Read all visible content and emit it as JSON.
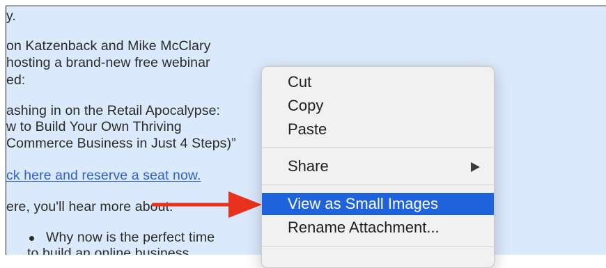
{
  "email": {
    "lines": [
      "y.",
      "on Katzenback and Mike McClary",
      " hosting a brand-new free webinar",
      "ed:",
      "ashing in on the Retail Apocalypse:",
      "w to Build Your Own Thriving",
      "Commerce Business in Just 4 Steps)”",
      "ck here and reserve a seat now.",
      "ere, you'll hear more about:",
      "Why now is the perfect time",
      "to build an online business"
    ]
  },
  "context_menu": {
    "items": [
      {
        "label": "Cut"
      },
      {
        "label": "Copy"
      },
      {
        "label": "Paste"
      },
      {
        "label": "Share",
        "submenu_icon": "chevron-right-icon"
      },
      {
        "label": "View as Small Images",
        "selected": true
      },
      {
        "label": "Rename Attachment..."
      }
    ]
  },
  "annotation": {
    "icon": "red-arrow-icon",
    "color": "#e8321e"
  },
  "colors": {
    "email_background": "#dbe9fc",
    "link": "#2d5fc7",
    "menu_background": "#f1f1f1",
    "selection": "#1f63dc"
  }
}
